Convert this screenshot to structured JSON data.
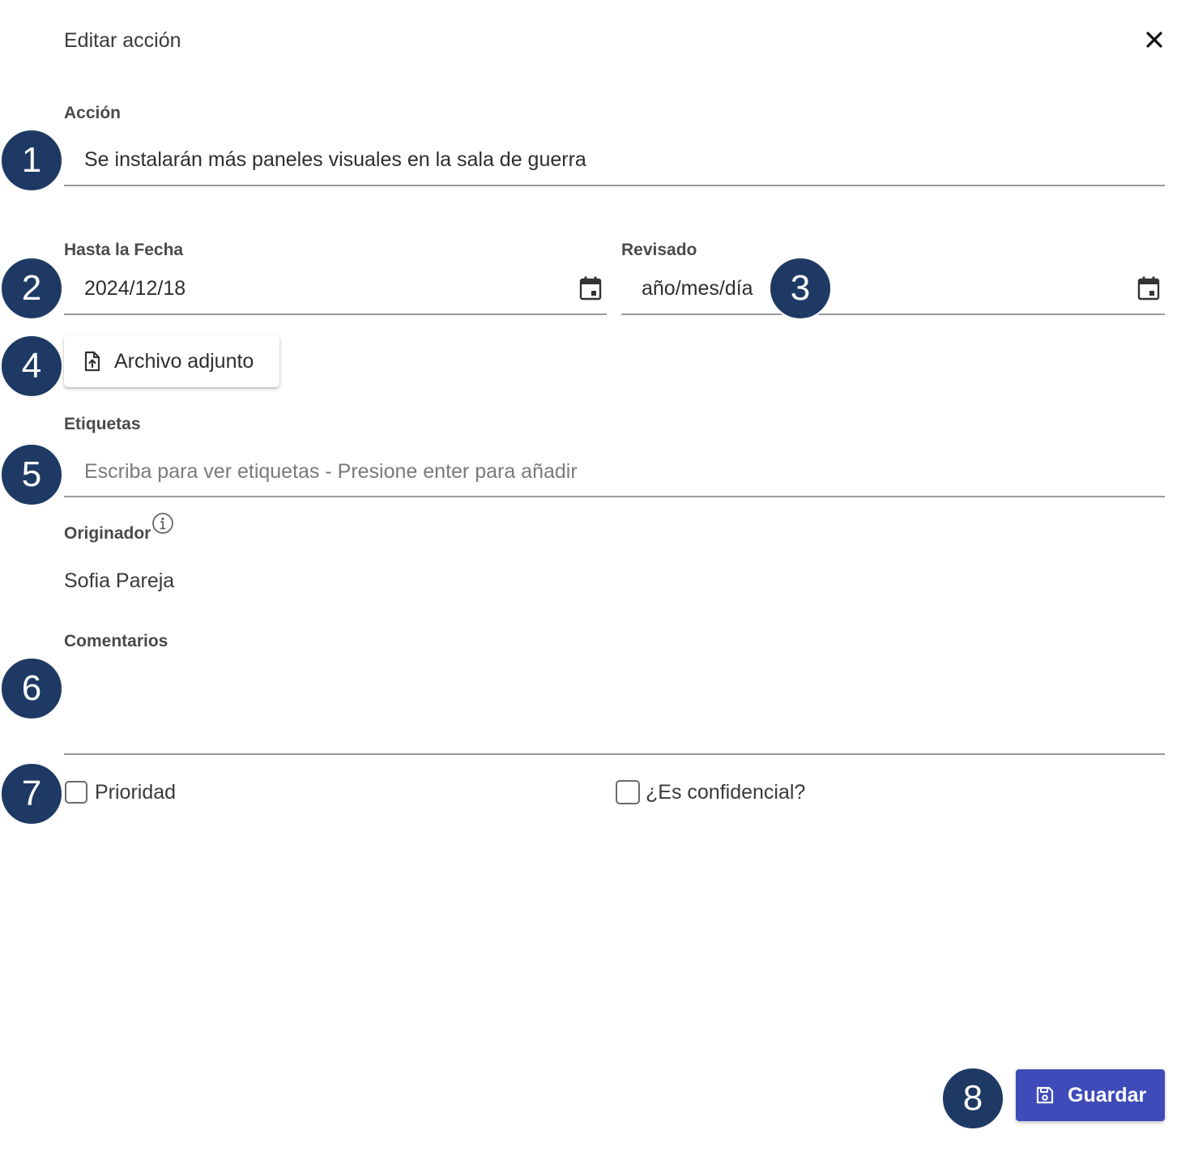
{
  "dialog": {
    "title": "Editar acción",
    "close_icon": "close-icon"
  },
  "accion": {
    "label": "Acción",
    "value": "Se instalarán más paneles visuales en la sala de guerra"
  },
  "hasta_la_fecha": {
    "label": "Hasta la Fecha",
    "value": "2024/12/18",
    "icon": "calendar-icon"
  },
  "revisado": {
    "label": "Revisado",
    "placeholder": "año/mes/día",
    "icon": "calendar-icon"
  },
  "attachment": {
    "label": "Archivo adjunto",
    "icon": "file-upload-icon"
  },
  "etiquetas": {
    "label": "Etiquetas",
    "placeholder": "Escriba para ver etiquetas - Presione enter para añadir"
  },
  "originador": {
    "label": "Originador",
    "value": "Sofia Pareja",
    "icon": "info-icon"
  },
  "comentarios": {
    "label": "Comentarios",
    "value": ""
  },
  "checkboxes": {
    "prioridad": {
      "label": "Prioridad",
      "checked": false
    },
    "confidencial": {
      "label": "¿Es confidencial?",
      "checked": false
    }
  },
  "save": {
    "label": "Guardar",
    "icon": "save-icon",
    "color": "#3f4bb8"
  },
  "steps": [
    "1",
    "2",
    "3",
    "4",
    "5",
    "6",
    "7",
    "8"
  ],
  "colors": {
    "badge": "#1e3a64",
    "primary": "#3f4bb8"
  }
}
